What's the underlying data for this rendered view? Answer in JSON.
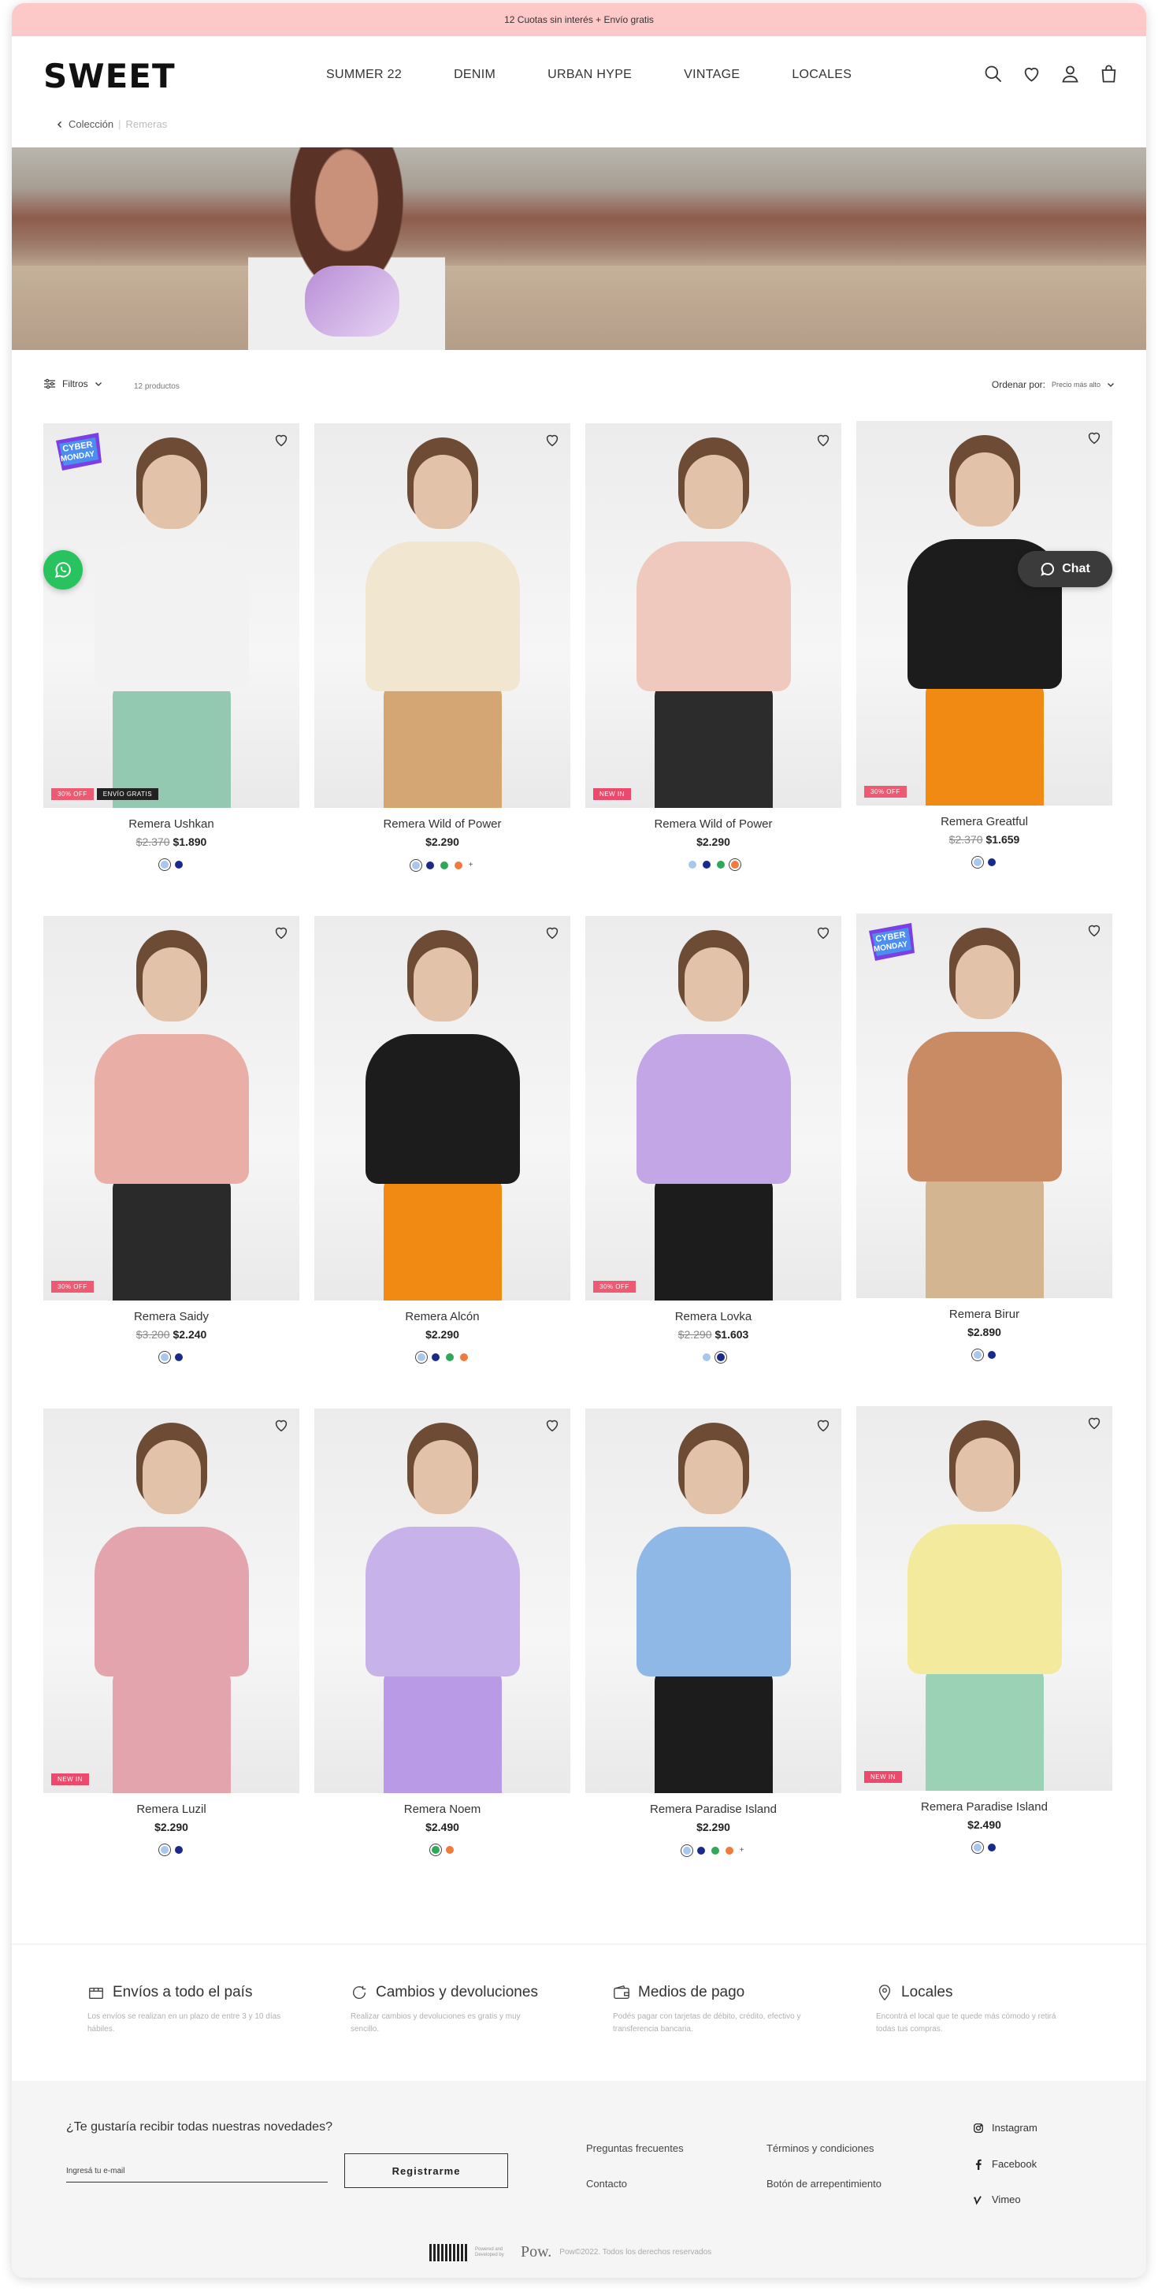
{
  "promo": {
    "text": "12 Cuotas sin interés + Envío gratis"
  },
  "brand": {
    "logo": "SWEET"
  },
  "nav": [
    {
      "label": "SUMMER 22"
    },
    {
      "label": "DENIM"
    },
    {
      "label": "URBAN HYPE"
    },
    {
      "label": "VINTAGE"
    },
    {
      "label": "LOCALES"
    }
  ],
  "header_icons": [
    "search-icon",
    "heart-icon",
    "user-icon",
    "bag-icon"
  ],
  "breadcrumb": {
    "parent": "Colección",
    "separator": "|",
    "current": "Remeras"
  },
  "toolbar": {
    "filters_label": "Filtros",
    "count_label": "12 productos",
    "sort_label": "Ordenar por:",
    "sort_value": "Precio más alto"
  },
  "products": [
    {
      "name": "Remera Ushkan",
      "old_price": "$2.370",
      "price": "$1.890",
      "badges": [
        "30% OFF",
        "ENVÍO GRATIS"
      ],
      "cyber": true,
      "colors": [
        "#a9c6ec",
        "#1a2a8c"
      ],
      "selected": 0,
      "more": "",
      "top": "#f2f2f2",
      "bottom": "#93c9b0"
    },
    {
      "name": "Remera Wild of Power",
      "old_price": "",
      "price": "$2.290",
      "badges": [],
      "cyber": false,
      "colors": [
        "#a9c6ec",
        "#1a2a8c",
        "#2fa85a",
        "#f07b3c"
      ],
      "selected": 0,
      "more": "+",
      "top": "#f1e6d0",
      "bottom": "#d3a674"
    },
    {
      "name": "Remera Wild of Power",
      "old_price": "",
      "price": "$2.290",
      "badges": [
        "NEW IN"
      ],
      "cyber": false,
      "colors": [
        "#a9c6ec",
        "#1a2a8c",
        "#2fa85a",
        "#f07b3c"
      ],
      "selected": 3,
      "more": "",
      "top": "#efc9bd",
      "bottom": "#2c2c2c"
    },
    {
      "name": "Remera Greatful",
      "old_price": "$2.370",
      "price": "$1.659",
      "badges": [
        "30% OFF"
      ],
      "cyber": false,
      "colors": [
        "#a9c6ec",
        "#1a2a8c"
      ],
      "selected": 0,
      "more": "",
      "top": "#1c1c1c",
      "bottom": "#f08a12"
    },
    {
      "name": "Remera Saidy",
      "old_price": "$3.200",
      "price": "$2.240",
      "badges": [
        "30% OFF"
      ],
      "cyber": false,
      "colors": [
        "#a9c6ec",
        "#1a2a8c"
      ],
      "selected": 0,
      "more": "",
      "top": "#e9aea6",
      "bottom": "#2a2a2a"
    },
    {
      "name": "Remera Alcón",
      "old_price": "",
      "price": "$2.290",
      "badges": [],
      "cyber": false,
      "colors": [
        "#a9c6ec",
        "#1a2a8c",
        "#2fa85a",
        "#f07b3c"
      ],
      "selected": 0,
      "more": "",
      "top": "#1c1c1c",
      "bottom": "#f08a12"
    },
    {
      "name": "Remera Lovka",
      "old_price": "$2.290",
      "price": "$1.603",
      "badges": [
        "30% OFF"
      ],
      "cyber": false,
      "colors": [
        "#a9c6ec",
        "#1a2a8c"
      ],
      "selected": 1,
      "more": "",
      "top": "#c3a6e6",
      "bottom": "#1c1c1c"
    },
    {
      "name": "Remera Birur",
      "old_price": "",
      "price": "$2.890",
      "badges": [],
      "cyber": true,
      "colors": [
        "#a9c6ec",
        "#1a2a8c"
      ],
      "selected": 0,
      "more": "",
      "top": "#c98b63",
      "bottom": "#d4b592"
    },
    {
      "name": "Remera Luzil",
      "old_price": "",
      "price": "$2.290",
      "badges": [
        "NEW IN"
      ],
      "cyber": false,
      "colors": [
        "#a9c6ec",
        "#1a2a8c"
      ],
      "selected": 0,
      "more": "",
      "top": "#e3a4ae",
      "bottom": "#e3a4ae"
    },
    {
      "name": "Remera Noem",
      "old_price": "",
      "price": "$2.490",
      "badges": [],
      "cyber": false,
      "colors": [
        "#2fa85a",
        "#f07b3c"
      ],
      "selected": 0,
      "more": "",
      "top": "#c7b3ea",
      "bottom": "#b89ae6"
    },
    {
      "name": "Remera Paradise Island",
      "old_price": "",
      "price": "$2.290",
      "badges": [],
      "cyber": false,
      "colors": [
        "#a9c6ec",
        "#1a2a8c",
        "#2fa85a",
        "#f07b3c"
      ],
      "selected": 0,
      "more": "+",
      "top": "#8fb8e6",
      "bottom": "#1c1c1c"
    },
    {
      "name": "Remera Paradise Island",
      "old_price": "",
      "price": "$2.490",
      "badges": [
        "NEW IN"
      ],
      "cyber": false,
      "colors": [
        "#a9c6ec",
        "#1a2a8c"
      ],
      "selected": 0,
      "more": "",
      "top": "#f3ea9e",
      "bottom": "#9bd2b6"
    }
  ],
  "chat": {
    "label": "Chat"
  },
  "features": [
    {
      "icon": "box-icon",
      "title": "Envíos a todo el país",
      "desc": "Los envíos se realizan en un plazo de entre 3 y 10 días hábiles."
    },
    {
      "icon": "refresh-icon",
      "title": "Cambios y devoluciones",
      "desc": "Realizar cambios y devoluciones es gratis y muy sencillo."
    },
    {
      "icon": "wallet-icon",
      "title": "Medios de pago",
      "desc": "Podés pagar con tarjetas de débito, crédito, efectivo y transferencia bancaria."
    },
    {
      "icon": "pin-icon",
      "title": "Locales",
      "desc": "Encontrá el local que te quede más cómodo y retirá todas tus compras."
    }
  ],
  "newsletter": {
    "title": "¿Te gustaría recibir todas nuestras novedades?",
    "placeholder": "Ingresá tu e-mail",
    "button": "Registrarme"
  },
  "footer_links": {
    "faq": "Preguntas frecuentes",
    "contact": "Contacto",
    "terms": "Términos y condiciones",
    "regret": "Botón de arrepentimiento"
  },
  "social": [
    {
      "icon": "instagram-icon",
      "label": "Instagram"
    },
    {
      "icon": "facebook-icon",
      "label": "Facebook"
    },
    {
      "icon": "vimeo-icon",
      "label": "Vimeo"
    }
  ],
  "copyright": {
    "powered": "Powered and Developed by",
    "pow": "Pow.",
    "text": "Pow©2022. Todos los derechos reservados"
  }
}
